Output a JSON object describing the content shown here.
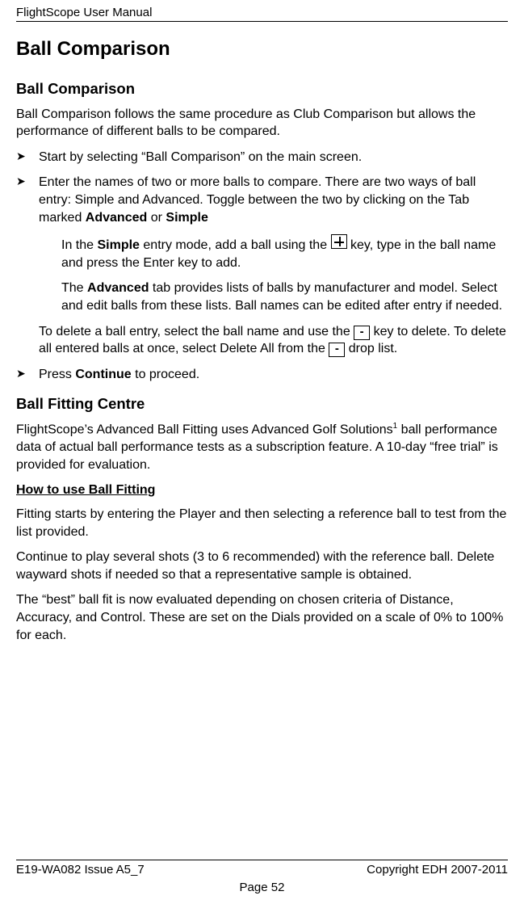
{
  "header": {
    "manual_title": "FlightScope User Manual"
  },
  "headings": {
    "h1": "Ball Comparison",
    "h2a": "Ball Comparison",
    "h2b": "Ball Fitting Centre",
    "h3": "How to use Ball Fitting"
  },
  "intro": "Ball Comparison follows the same procedure as Club Comparison but allows the performance of different balls to be compared.",
  "bullets": {
    "b1": "Start by selecting “Ball Comparison” on the main screen.",
    "b2_pre": "Enter the names of two or more balls to compare. There are two ways of ball entry: Simple and Advanced. Toggle between the two by clicking on the Tab marked ",
    "b2_adv": "Advanced",
    "b2_or": " or ",
    "b2_sim": "Simple",
    "b3_pre": "Press ",
    "b3_cont": "Continue",
    "b3_post": " to proceed."
  },
  "detail": {
    "simple_pre": "In the ",
    "simple_bold": "Simple",
    "simple_mid": " entry mode, add a ball using the ",
    "simple_post": " key, type in the ball name and press the Enter key to add.",
    "adv_pre": "The ",
    "adv_bold": "Advanced",
    "adv_post": " tab provides lists of balls by manufacturer and model. Select and edit balls from these lists. Ball names can be edited after entry if needed.",
    "delete_pre": "To delete a ball entry, select the ball name and use the ",
    "delete_mid": " key to delete. To delete all entered balls at once, select Delete All from the ",
    "delete_post": " drop list."
  },
  "fitting": {
    "p1_pre": "FlightScope’s Advanced Ball Fitting uses Advanced Golf Solutions",
    "p1_sup": "1",
    "p1_post": " ball performance data of actual ball performance tests as a subscription feature. A 10-day “free trial” is provided for evaluation.",
    "p2": "Fitting starts by entering the Player and then selecting a reference ball to test from the list provided.",
    "p3": "Continue to play several shots (3 to 6 recommended) with the reference ball. Delete wayward shots if needed so that a representative sample is obtained.",
    "p4": "The “best” ball fit is now evaluated depending on chosen criteria of Distance, Accuracy, and Control. These are set on the Dials provided on a scale of 0% to 100% for each."
  },
  "keys": {
    "minus": "-"
  },
  "footer": {
    "left": "E19-WA082 Issue A5_7",
    "right": "Copyright EDH 2007-2011",
    "center": "Page 52"
  }
}
